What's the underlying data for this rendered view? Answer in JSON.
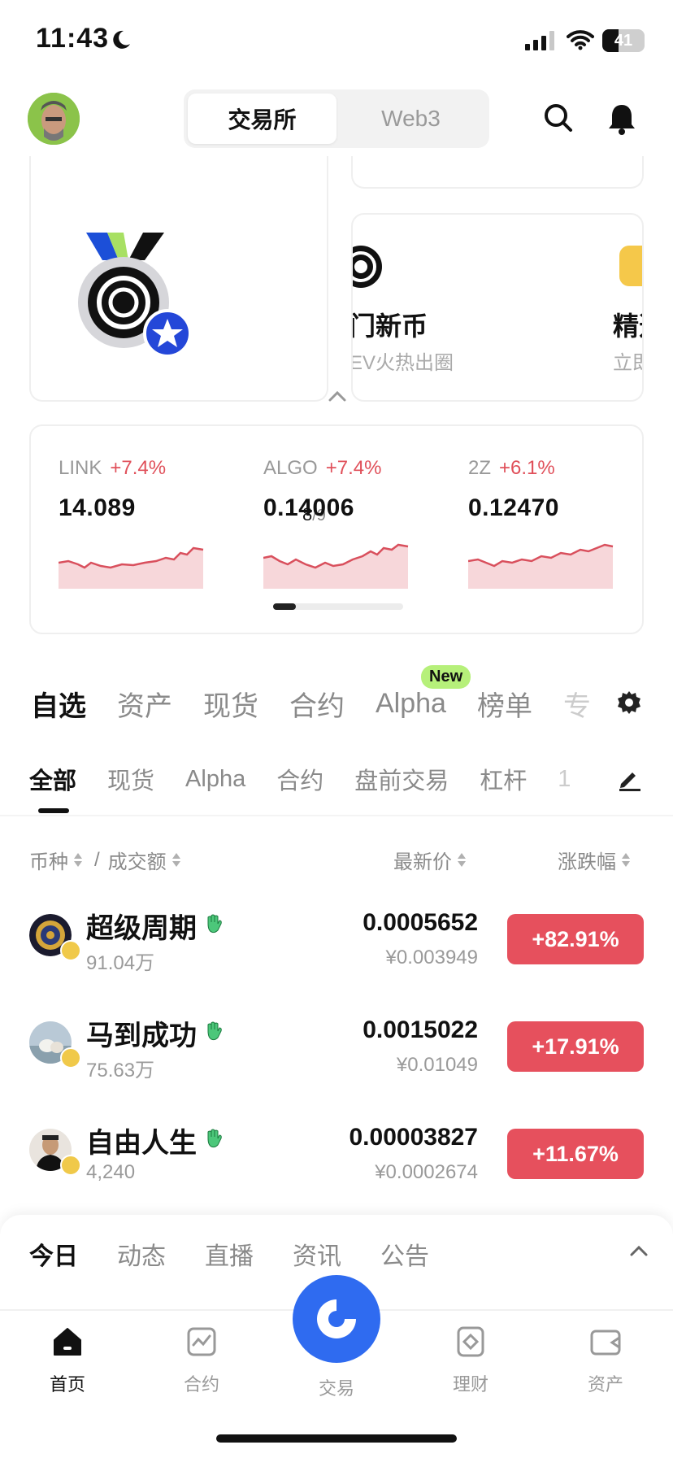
{
  "status_bar": {
    "time": "11:43",
    "battery": "41"
  },
  "header": {
    "segments": [
      {
        "label": "交易所"
      },
      {
        "label": "Web3"
      }
    ]
  },
  "banner": {
    "pager_current": "8",
    "pager_total": "/9",
    "card_title": "门新币",
    "card_subtitle": "EV火热出圈",
    "card2_title": "精选",
    "card2_subtitle": "立即"
  },
  "tickers": [
    {
      "symbol": "LINK",
      "change": "+7.4%",
      "price": "14.089"
    },
    {
      "symbol": "ALGO",
      "change": "+7.4%",
      "price": "0.14006"
    },
    {
      "symbol": "2Z",
      "change": "+6.1%",
      "price": "0.12470"
    }
  ],
  "main_tabs": [
    {
      "label": "自选"
    },
    {
      "label": "资产"
    },
    {
      "label": "现货"
    },
    {
      "label": "合约"
    },
    {
      "label": "Alpha"
    },
    {
      "label": "榜单"
    },
    {
      "label": "专"
    }
  ],
  "new_badge": "New",
  "sub_tabs": [
    {
      "label": "全部"
    },
    {
      "label": "现货"
    },
    {
      "label": "Alpha"
    },
    {
      "label": "合约"
    },
    {
      "label": "盘前交易"
    },
    {
      "label": "杠杆"
    },
    {
      "label": "1"
    }
  ],
  "columns": {
    "coin": "币种",
    "separator": "/",
    "volume": "成交额",
    "price": "最新价",
    "change": "涨跌幅"
  },
  "rows": [
    {
      "name": "超级周期",
      "volume": "91.04万",
      "price": "0.0005652",
      "price_cny": "¥0.003949",
      "change": "+82.91%"
    },
    {
      "name": "马到成功",
      "volume": "75.63万",
      "price": "0.0015022",
      "price_cny": "¥0.01049",
      "change": "+17.91%"
    },
    {
      "name": "自由人生",
      "volume": "4,240",
      "price": "0.00003827",
      "price_cny": "¥0.0002674",
      "change": "+11.67%"
    }
  ],
  "news_tabs": [
    {
      "label": "今日"
    },
    {
      "label": "动态"
    },
    {
      "label": "直播"
    },
    {
      "label": "资讯"
    },
    {
      "label": "公告"
    }
  ],
  "bottom_nav": [
    {
      "label": "首页",
      "icon": "home-icon"
    },
    {
      "label": "合约",
      "icon": "chart-icon"
    },
    {
      "label": "交易",
      "icon": "trade-icon"
    },
    {
      "label": "理财",
      "icon": "earn-icon"
    },
    {
      "label": "资产",
      "icon": "wallet-icon"
    }
  ],
  "colors": {
    "up": "#e6505d",
    "accent": "#2f6bf0",
    "new_badge": "#b6f07a"
  }
}
